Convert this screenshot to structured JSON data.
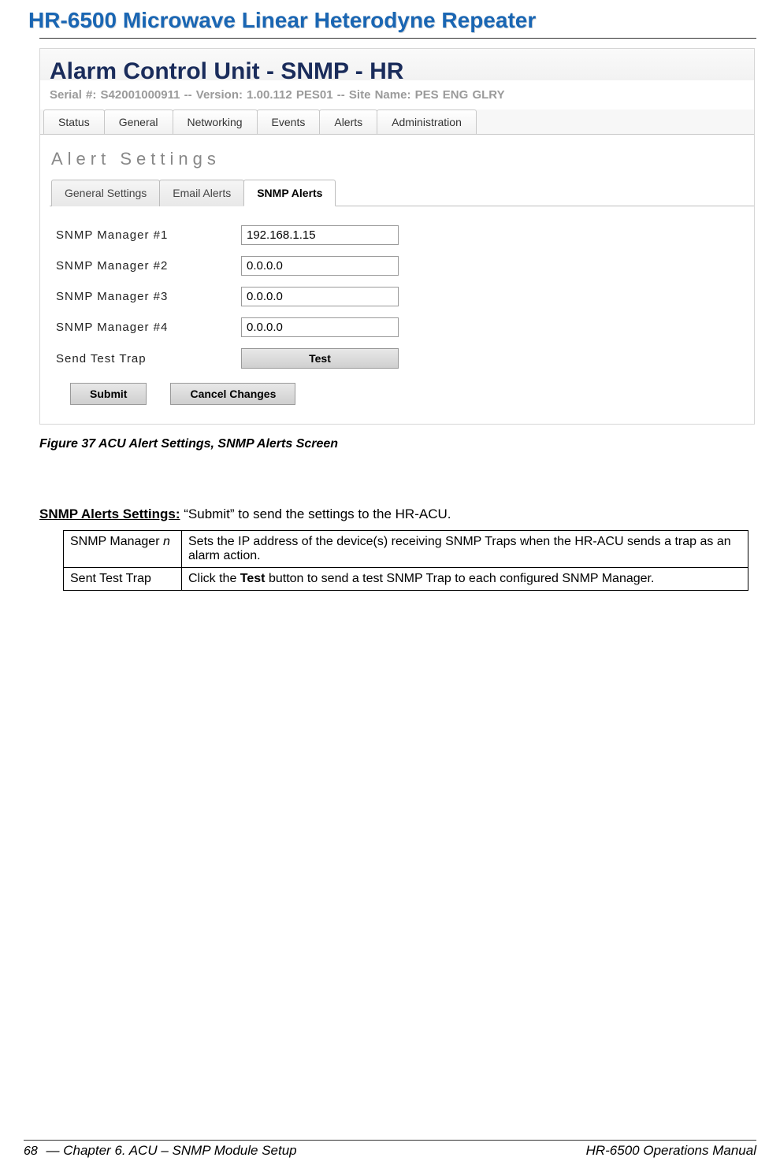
{
  "doc_title": "HR-6500 Microwave Linear Heterodyne Repeater",
  "screenshot": {
    "title": "Alarm Control Unit - SNMP - HR",
    "subtitle": "Serial #: S42001000911   --   Version: 1.00.112 PES01   --   Site Name:  PES ENG GLRY",
    "main_tabs": [
      "Status",
      "General",
      "Networking",
      "Events",
      "Alerts",
      "Administration"
    ],
    "section_heading": "Alert Settings",
    "sub_tabs": {
      "items": [
        "General Settings",
        "Email Alerts",
        "SNMP Alerts"
      ],
      "active_index": 2
    },
    "fields": [
      {
        "label": "SNMP Manager #1",
        "value": "192.168.1.15"
      },
      {
        "label": "SNMP Manager #2",
        "value": "0.0.0.0"
      },
      {
        "label": "SNMP Manager #3",
        "value": "0.0.0.0"
      },
      {
        "label": "SNMP Manager #4",
        "value": "0.0.0.0"
      }
    ],
    "test_row_label": "Send Test Trap",
    "test_button": "Test",
    "submit": "Submit",
    "cancel": "Cancel Changes"
  },
  "figure_caption": "Figure 37  ACU Alert Settings, SNMP Alerts Screen",
  "settings_line": {
    "title": "SNMP Alerts Settings:",
    "rest": " “Submit” to send the settings to the HR-ACU."
  },
  "table": {
    "row1": {
      "c1a": "SNMP Manager ",
      "c1b": "n",
      "c2": "Sets the IP address of the device(s) receiving SNMP Traps when the HR-ACU sends a trap as an alarm action."
    },
    "row2": {
      "c1": "Sent Test Trap",
      "c2a": "Click the ",
      "c2b": "Test",
      "c2c": " button to send a test SNMP Trap to each configured SNMP Manager."
    }
  },
  "footer": {
    "page": "68",
    "left": " — Chapter 6. ACU – SNMP Module Setup",
    "right": "HR-6500 Operations Manual"
  }
}
